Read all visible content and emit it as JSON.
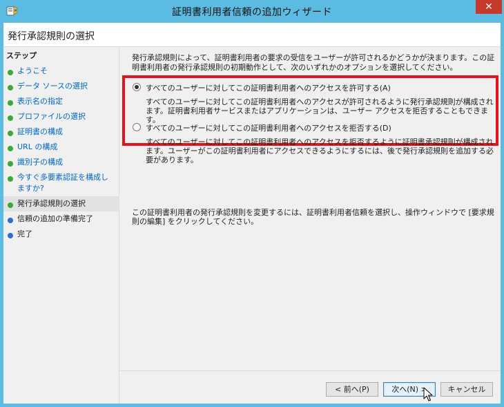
{
  "window": {
    "title": "証明書利用者信頼の追加ウィザード",
    "close_glyph": "✕"
  },
  "header": {
    "page_title": "発行承認規則の選択"
  },
  "sidebar": {
    "label": "ステップ",
    "items": [
      {
        "label": "ようこそ",
        "status": "done"
      },
      {
        "label": "データ ソースの選択",
        "status": "done"
      },
      {
        "label": "表示名の指定",
        "status": "done"
      },
      {
        "label": "プロファイルの選択",
        "status": "done"
      },
      {
        "label": "証明書の構成",
        "status": "done"
      },
      {
        "label": "URL の構成",
        "status": "done"
      },
      {
        "label": "識別子の構成",
        "status": "done"
      },
      {
        "label": "今すぐ多要素認証を構成しますか?",
        "status": "done"
      },
      {
        "label": "発行承認規則の選択",
        "status": "current"
      },
      {
        "label": "信頼の追加の準備完了",
        "status": "todo"
      },
      {
        "label": "完了",
        "status": "todo"
      }
    ]
  },
  "main": {
    "intro": "発行承認規則によって、証明書利用者の要求の受信をユーザーが許可されるかどうかが決まります。この証明書利用者の発行承認規則の初期動作として、次のいずれかのオプションを選択してください。",
    "options": [
      {
        "label": "すべてのユーザーに対してこの証明書利用者へのアクセスを許可する(A)",
        "description": "すべてのユーザーに対してこの証明書利用者へのアクセスが許可されるように発行承認規則が構成されます。証明書利用者サービスまたはアプリケーションは、ユーザー アクセスを拒否することもできます。",
        "checked": true
      },
      {
        "label": "すべてのユーザーに対してこの証明書利用者へのアクセスを拒否する(D)",
        "description": "すべてのユーザーに対してこの証明書利用者へのアクセスを拒否するように証明書承認規則が構成されます。ユーザーがこの証明書利用者にアクセスできるようにするには、後で発行承認規則を追加する必要があります。",
        "checked": false
      }
    ],
    "footer_note": "この証明書利用者の発行承認規則を変更するには、証明書利用者信頼を選択し、操作ウィンドウで [要求規則の編集] をクリックしてください。"
  },
  "buttons": {
    "back": "< 前へ(P)",
    "next": "次へ(N) >",
    "cancel": "キャンセル"
  },
  "colors": {
    "title_bar": "#5bbbe2",
    "close_button": "#c7392b",
    "highlight_border": "#e0141d",
    "step_done_bullet": "#3aaa35",
    "step_todo_bullet": "#2a6ed8",
    "link_text": "#0066cc"
  },
  "icons": {
    "app": "adfs-wizard-icon",
    "cursor": "mouse-pointer-icon"
  }
}
